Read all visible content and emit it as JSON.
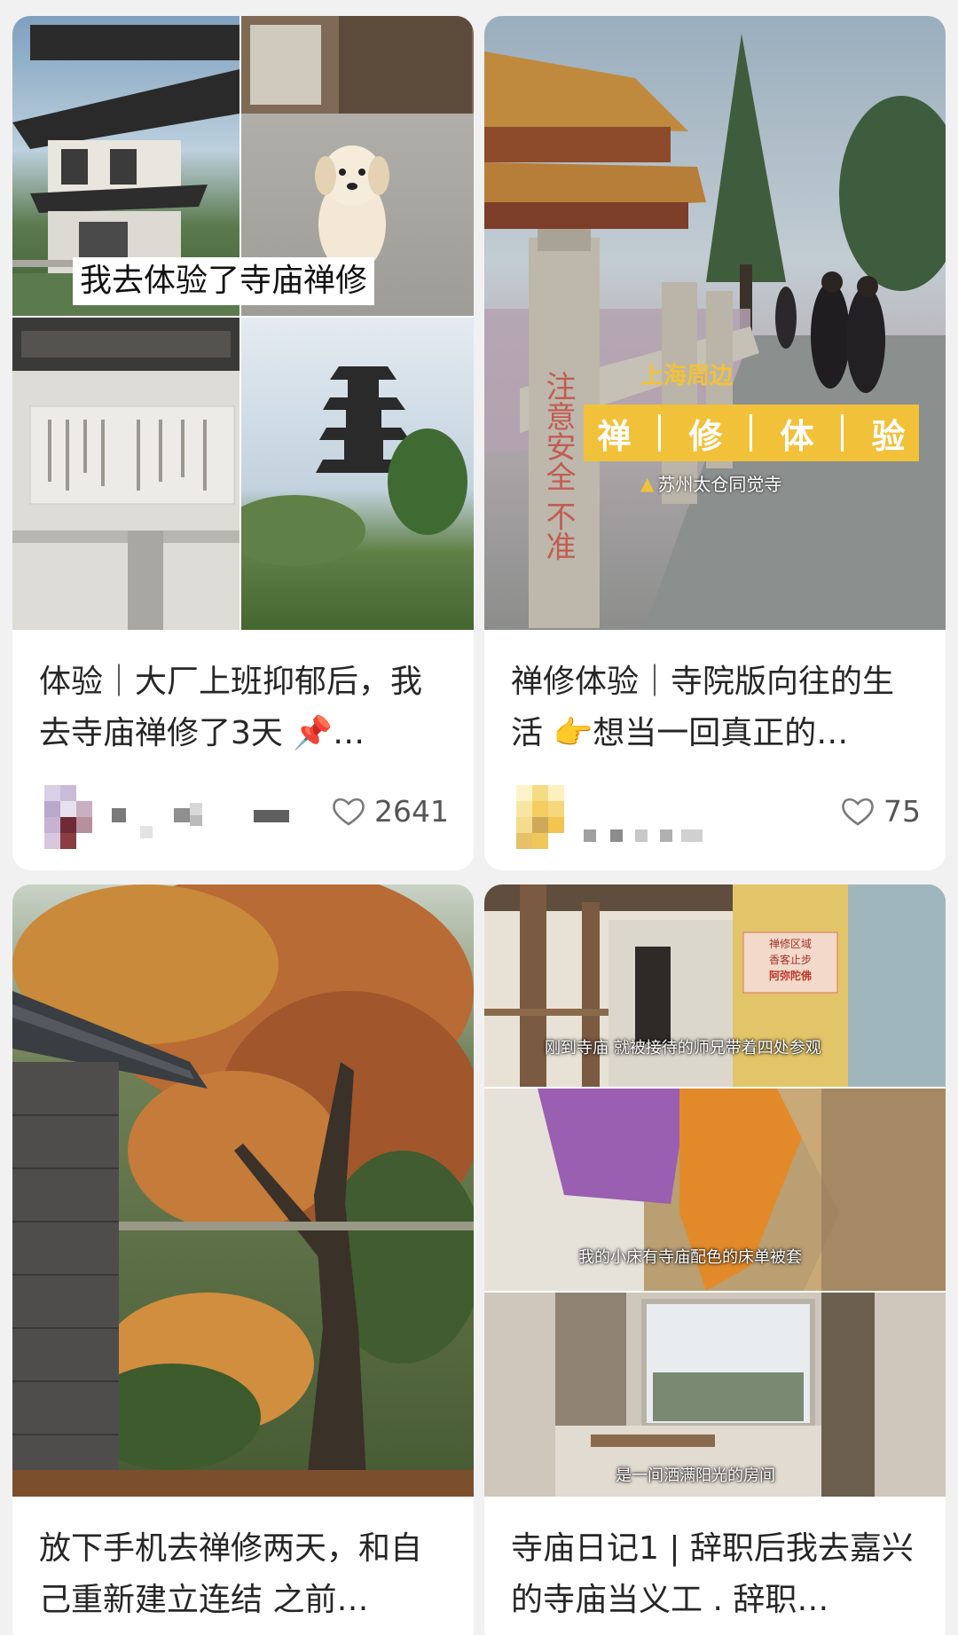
{
  "feed": {
    "cards": [
      {
        "title": "体验｜大厂上班抑郁后，我去寺庙禅修了3天 📌…",
        "likes": "2641",
        "image": {
          "overlay_text": "我去体验了寺庙禅修"
        }
      },
      {
        "title": "禅修体验｜寺院版向往的生活 👉想当一回真正的…",
        "likes": "75",
        "image": {
          "tag_top": "上海周边",
          "banner_chars": [
            "禅",
            "修",
            "体",
            "验"
          ],
          "location": "苏州太仓同觉寺",
          "stone_text": "注意安全 不准"
        }
      },
      {
        "title": "放下手机去禅修两天，和自己重新建立连结 之前…",
        "image": {}
      },
      {
        "title": "寺庙日记1 | 辞职后我去嘉兴的寺庙当义工 . 辞职…",
        "image": {
          "sign_lines": [
            "禅修区域",
            "香客止步",
            "阿弥陀佛"
          ],
          "captions": [
            "刚到寺庙 就被接待的师兄带着四处参观",
            "我的小床有寺庙配色的床单被套",
            "是一间洒满阳光的房间"
          ]
        }
      }
    ]
  },
  "icons": {
    "like": "heart-outline-icon",
    "location": "location-pin-icon"
  },
  "colors": {
    "background": "#f1f1f1",
    "card": "#ffffff",
    "title": "#262626",
    "banner": "#f2c13a"
  }
}
